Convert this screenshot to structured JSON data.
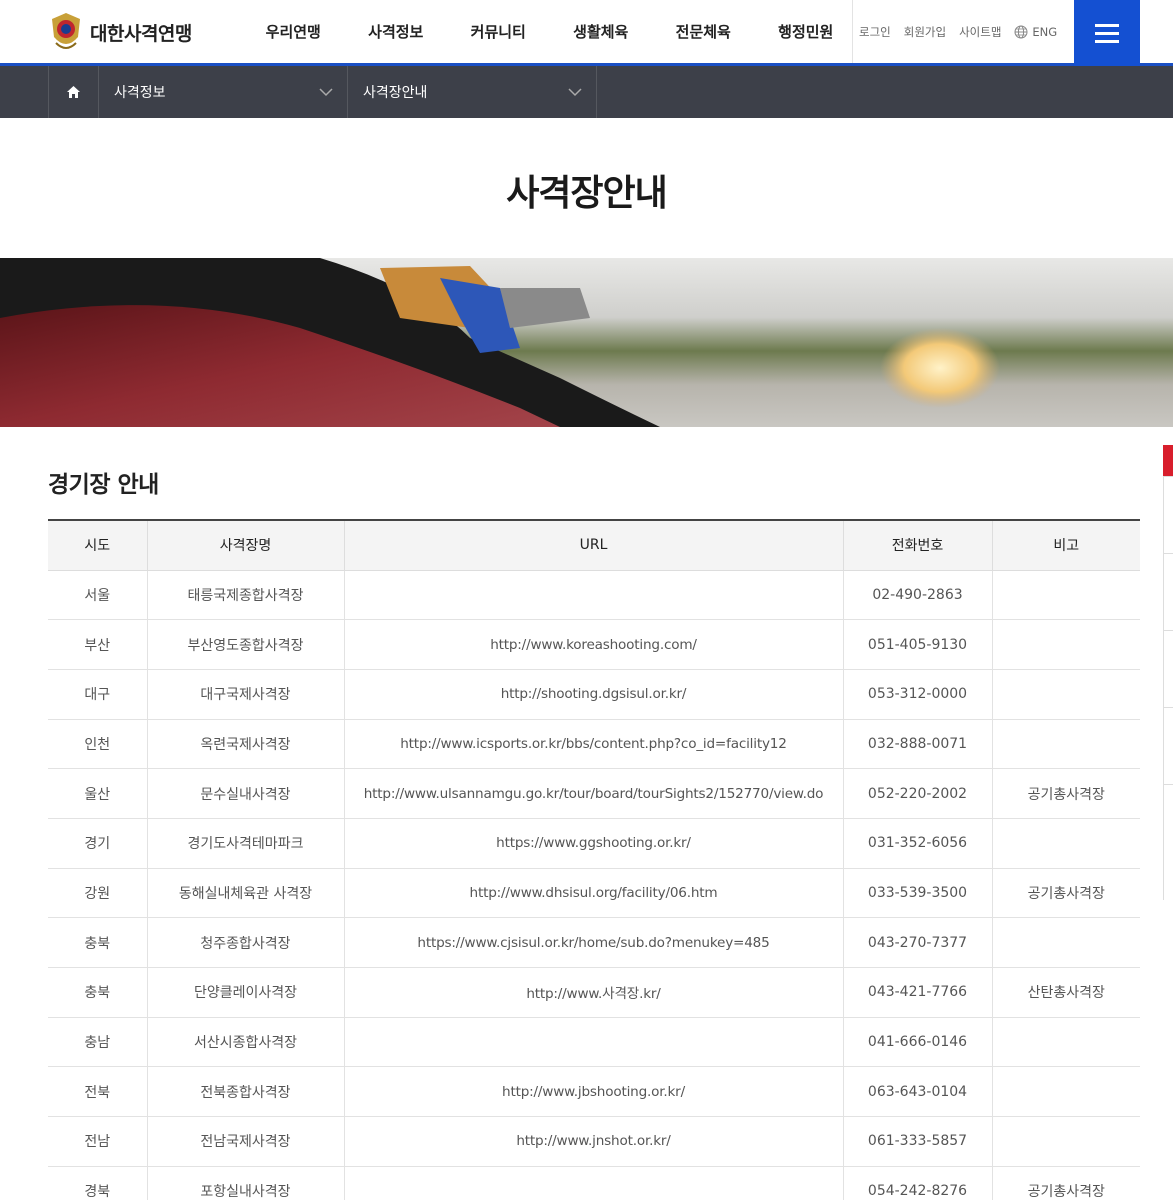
{
  "header": {
    "logo_text": "대한사격연맹",
    "nav": [
      "우리연맹",
      "사격정보",
      "커뮤니티",
      "생활체육",
      "전문체육",
      "행정민원"
    ],
    "util": {
      "login": "로그인",
      "join": "회원가입",
      "sitemap": "사이트맵",
      "lang": "ENG"
    },
    "accent_color": "#1450d2"
  },
  "breadcrumb": {
    "level1": "사격정보",
    "level2": "사격장안내"
  },
  "page": {
    "title": "사격장안내",
    "section_title": "경기장 안내"
  },
  "table": {
    "headers": [
      "시도",
      "사격장명",
      "URL",
      "전화번호",
      "비고"
    ],
    "rows": [
      [
        "서울",
        "태릉국제종합사격장",
        "",
        "02-490-2863",
        ""
      ],
      [
        "부산",
        "부산영도종합사격장",
        "http://www.koreashooting.com/",
        "051-405-9130",
        ""
      ],
      [
        "대구",
        "대구국제사격장",
        "http://shooting.dgsisul.or.kr/",
        "053-312-0000",
        ""
      ],
      [
        "인천",
        "옥련국제사격장",
        "http://www.icsports.or.kr/bbs/content.php?co_id=facility12",
        "032-888-0071",
        ""
      ],
      [
        "울산",
        "문수실내사격장",
        "http://www.ulsannamgu.go.kr/tour/board/tourSights2/152770/view.do",
        "052-220-2002",
        "공기총사격장"
      ],
      [
        "경기",
        "경기도사격테마파크",
        "https://www.ggshooting.or.kr/",
        "031-352-6056",
        ""
      ],
      [
        "강원",
        "동해실내체육관 사격장",
        "http://www.dhsisul.org/facility/06.htm",
        "033-539-3500",
        "공기총사격장"
      ],
      [
        "충북",
        "청주종합사격장",
        "https://www.cjsisul.or.kr/home/sub.do?menukey=485",
        "043-270-7377",
        ""
      ],
      [
        "충북",
        "단양클레이사격장",
        "http://www.사격장.kr/",
        "043-421-7766",
        "산탄총사격장"
      ],
      [
        "충남",
        "서산시종합사격장",
        "",
        "041-666-0146",
        ""
      ],
      [
        "전북",
        "전북종합사격장",
        "http://www.jbshooting.or.kr/",
        "063-643-0104",
        ""
      ],
      [
        "전남",
        "전남국제사격장",
        "http://www.jnshot.or.kr/",
        "061-333-5857",
        ""
      ],
      [
        "경북",
        "포항실내사격장",
        "",
        "054-242-8276",
        "공기총사격장"
      ]
    ]
  },
  "icons": {
    "home": "home-icon",
    "chevron": "chevron-down-icon",
    "globe": "globe-icon",
    "menu": "hamburger-menu-icon",
    "logo": "federation-emblem-icon"
  }
}
